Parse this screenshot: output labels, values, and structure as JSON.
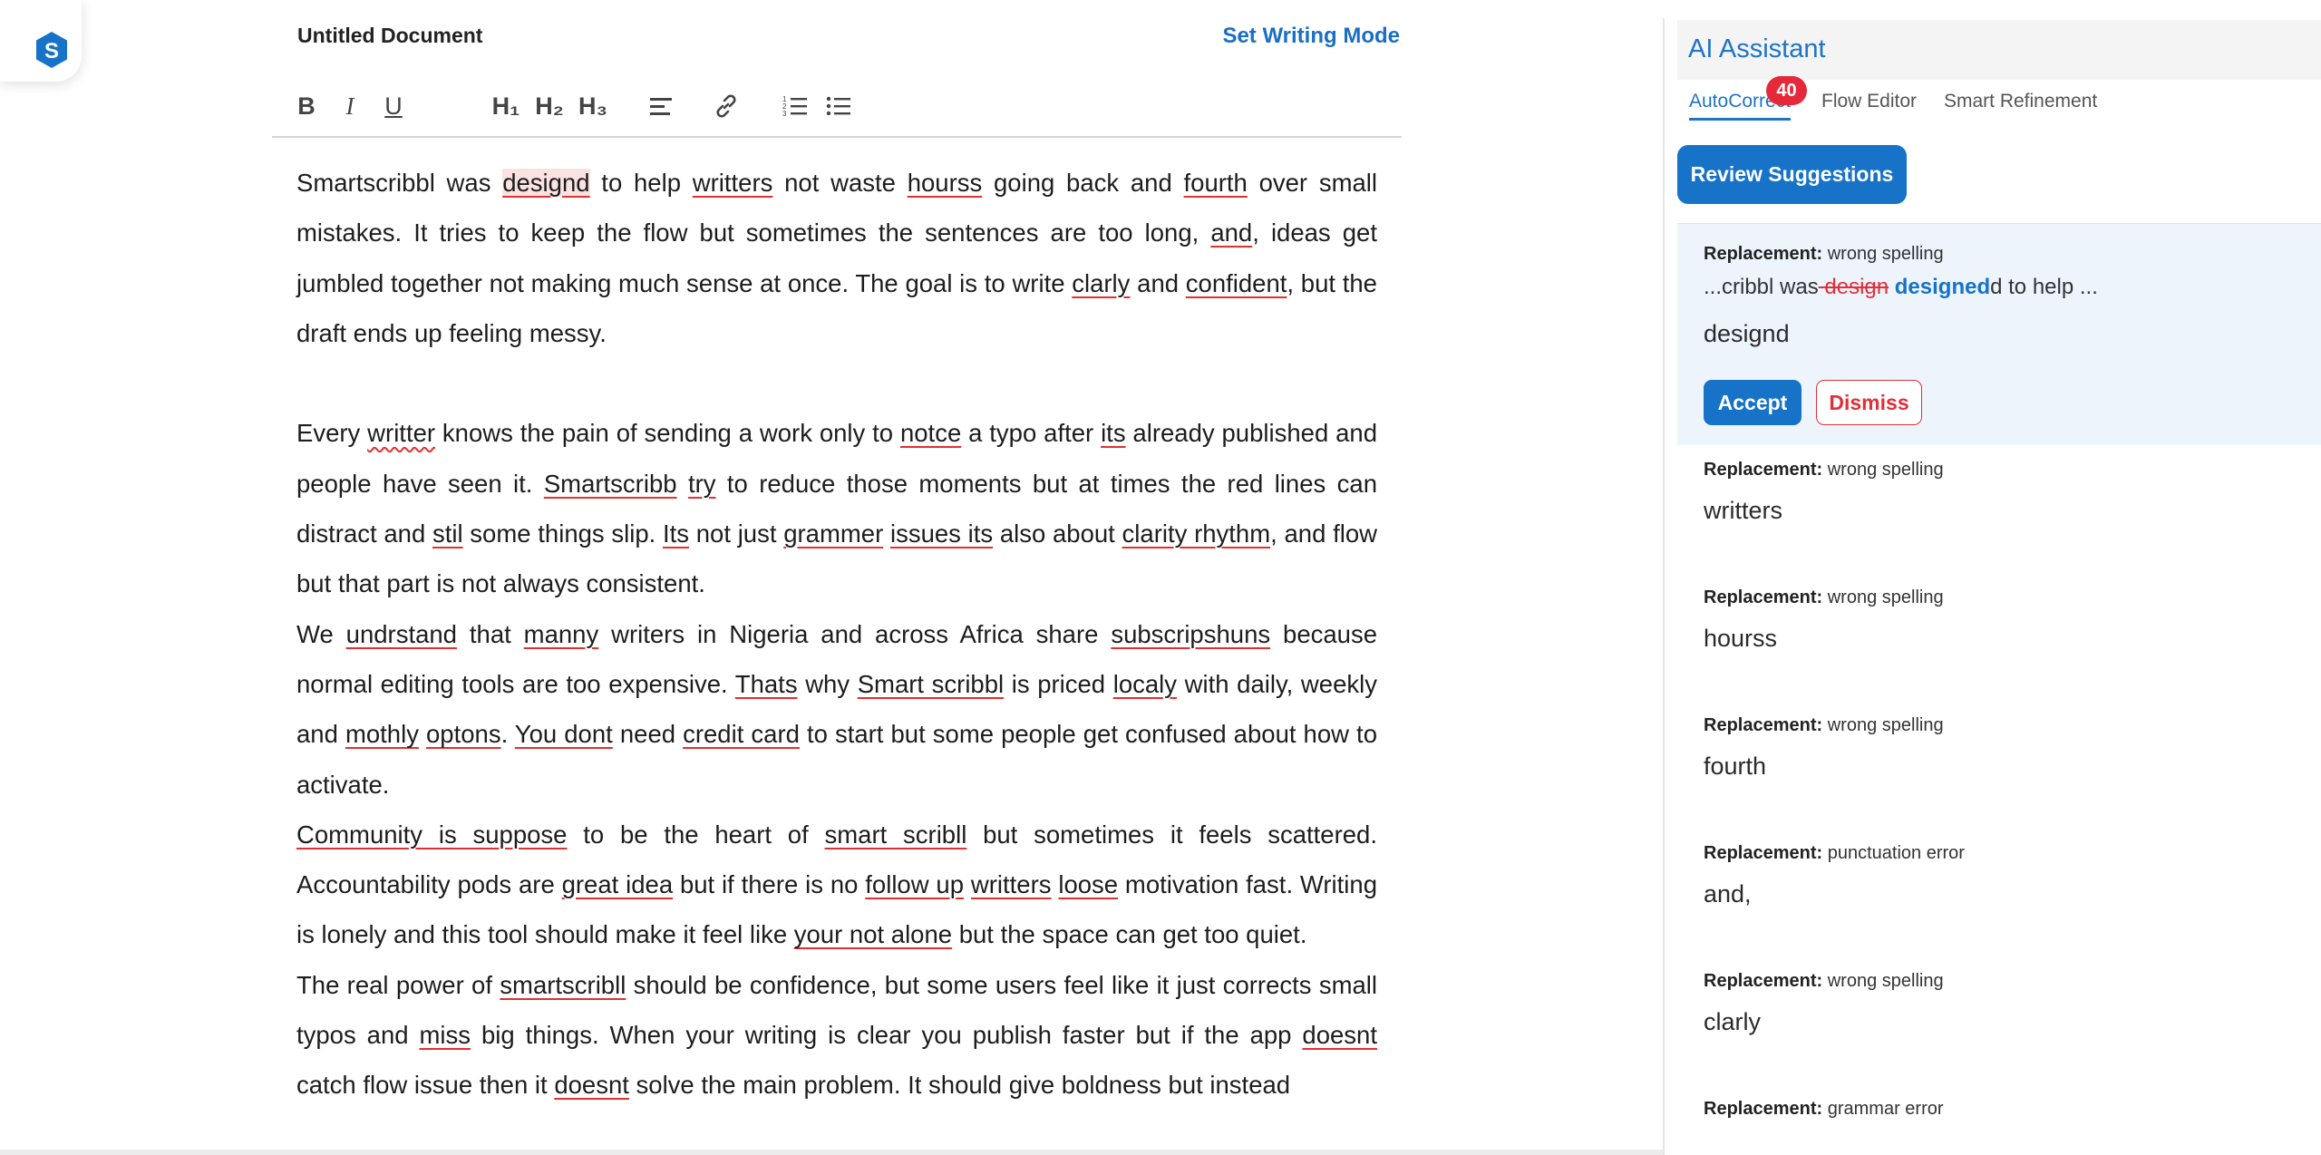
{
  "document": {
    "title": "Untitled Document",
    "mode_link": "Set Writing Mode"
  },
  "toolbar": {
    "bold": "B",
    "italic": "I",
    "underline": "U",
    "h1": "H₁",
    "h2": "H₂",
    "h3": "H₃"
  },
  "editor": {
    "paragraphs": [
      [
        {
          "t": "Smartscribbl was "
        },
        {
          "t": "designd",
          "e": "hl"
        },
        {
          "t": " to help "
        },
        {
          "t": "writters",
          "e": "u"
        },
        {
          "t": " not waste "
        },
        {
          "t": "hourss",
          "e": "u"
        },
        {
          "t": " going back and "
        },
        {
          "t": "fourth",
          "e": "u"
        },
        {
          "t": " over small mistakes. It tries to keep the flow but sometimes the sentences are too long, "
        },
        {
          "t": "and",
          "e": "u"
        },
        {
          "t": ", ideas get jumbled together not making much sense at once. The goal is to write "
        },
        {
          "t": "clarly",
          "e": "u"
        },
        {
          "t": " and "
        },
        {
          "t": "confident",
          "e": "u"
        },
        {
          "t": ", but the draft ends up feeling messy."
        }
      ],
      [],
      [
        {
          "t": "Every "
        },
        {
          "t": "writter",
          "e": "w"
        },
        {
          "t": " knows the pain of sending a work only to "
        },
        {
          "t": "notce",
          "e": "u"
        },
        {
          "t": " a typo after "
        },
        {
          "t": "its",
          "e": "u"
        },
        {
          "t": " already published and people have seen it. "
        },
        {
          "t": "Smartscribb",
          "e": "u"
        },
        {
          "t": " "
        },
        {
          "t": "try",
          "e": "u"
        },
        {
          "t": " to reduce those moments but at times the red lines can distract and "
        },
        {
          "t": "stil",
          "e": "u"
        },
        {
          "t": " some things slip. "
        },
        {
          "t": "Its",
          "e": "u"
        },
        {
          "t": " not just "
        },
        {
          "t": "grammer",
          "e": "u"
        },
        {
          "t": " "
        },
        {
          "t": "issues its",
          "e": "u"
        },
        {
          "t": " also about "
        },
        {
          "t": "clarity rhythm",
          "e": "u"
        },
        {
          "t": ", and flow but that part is not always consistent."
        }
      ],
      [
        {
          "t": "We "
        },
        {
          "t": "undrstand",
          "e": "u"
        },
        {
          "t": " that "
        },
        {
          "t": "manny",
          "e": "u"
        },
        {
          "t": " writers in Nigeria and across Africa share "
        },
        {
          "t": "subscripshuns",
          "e": "u"
        },
        {
          "t": " because normal editing tools are too expensive. "
        },
        {
          "t": "Thats",
          "e": "u"
        },
        {
          "t": " why "
        },
        {
          "t": "Smart scribbl",
          "e": "u"
        },
        {
          "t": " is priced "
        },
        {
          "t": "localy",
          "e": "u"
        },
        {
          "t": " with daily, weekly and "
        },
        {
          "t": "mothly",
          "e": "u"
        },
        {
          "t": " "
        },
        {
          "t": "optons",
          "e": "u"
        },
        {
          "t": ". "
        },
        {
          "t": "You dont",
          "e": "u"
        },
        {
          "t": " need "
        },
        {
          "t": "credit card",
          "e": "u"
        },
        {
          "t": " to start but some people get confused about how to activate."
        }
      ],
      [
        {
          "t": "Community is suppose",
          "e": "u"
        },
        {
          "t": " to be the heart of "
        },
        {
          "t": "smart scribll",
          "e": "u"
        },
        {
          "t": " but sometimes it feels scattered. Accountability pods are "
        },
        {
          "t": "great idea",
          "e": "u"
        },
        {
          "t": " but if there is no "
        },
        {
          "t": "follow up",
          "e": "u"
        },
        {
          "t": " "
        },
        {
          "t": "writters",
          "e": "u"
        },
        {
          "t": " "
        },
        {
          "t": "loose",
          "e": "u"
        },
        {
          "t": " motivation fast. Writing is lonely and this tool should make it feel like "
        },
        {
          "t": "your not alone",
          "e": "u"
        },
        {
          "t": " but the space can get too quiet."
        }
      ],
      [
        {
          "t": "The real power of "
        },
        {
          "t": "smartscribll",
          "e": "u"
        },
        {
          "t": " should be confidence, but some users feel like it just corrects small typos and "
        },
        {
          "t": "miss",
          "e": "u"
        },
        {
          "t": " big things. When your writing is clear you publish faster but if the app "
        },
        {
          "t": "doesnt",
          "e": "u"
        },
        {
          "t": " catch flow issue then it "
        },
        {
          "t": "doesnt",
          "e": "u"
        },
        {
          "t": " solve the main problem. It should give boldness but instead"
        }
      ]
    ]
  },
  "assistant": {
    "title": "AI Assistant",
    "tabs": [
      "AutoCorrect",
      "Flow Editor",
      "Smart Refinement"
    ],
    "badge_count": "40",
    "review_button": "Review Suggestions",
    "active_suggestion": {
      "label_prefix": "Replacement:",
      "label_type": "wrong spelling",
      "context_before": "...cribbl was",
      "context_deleted": " design",
      "context_inserted": " designed",
      "context_after": "d to help ...",
      "word": "designd",
      "accept": "Accept",
      "dismiss": "Dismiss"
    },
    "suggestions": [
      {
        "prefix": "Replacement:",
        "type": "wrong spelling",
        "word": "writters"
      },
      {
        "prefix": "Replacement:",
        "type": "wrong spelling",
        "word": "hourss"
      },
      {
        "prefix": "Replacement:",
        "type": "wrong spelling",
        "word": "fourth"
      },
      {
        "prefix": "Replacement:",
        "type": "punctuation error",
        "word": "and,"
      },
      {
        "prefix": "Replacement:",
        "type": "wrong spelling",
        "word": "clarly"
      },
      {
        "prefix": "Replacement:",
        "type": "grammar error",
        "word": ""
      }
    ]
  },
  "colors": {
    "accent": "#1673c8",
    "error": "#e03030",
    "badge": "#e5283a"
  }
}
